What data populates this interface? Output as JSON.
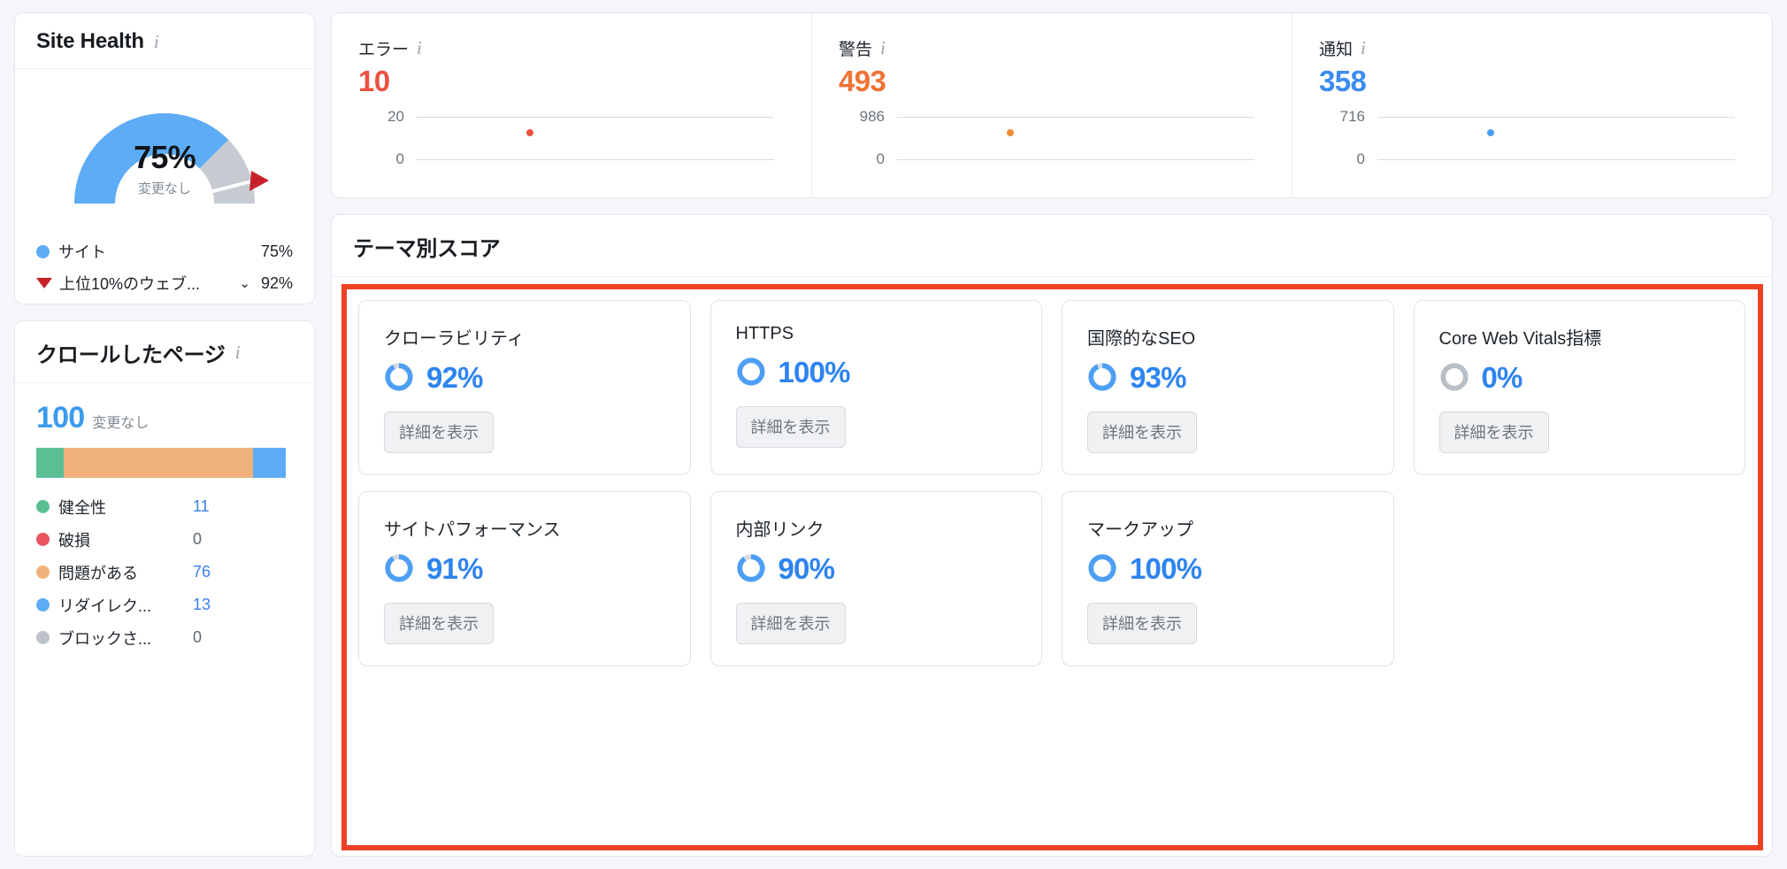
{
  "site_health": {
    "title": "Site Health",
    "info_icon": "info-icon",
    "gauge": {
      "value_label": "75%",
      "value": 75,
      "change_label": "変更なし",
      "benchmark": 92,
      "arc_color": "#5dacf5",
      "track_color": "#c6cbd1",
      "marker_color": "#c7222a"
    },
    "legend": [
      {
        "marker": "dot",
        "color": "#5dacf5",
        "label": "サイト",
        "value": "75%",
        "has_chevron": false
      },
      {
        "marker": "triangle-down",
        "color": "#c7222a",
        "label": "上位10%のウェブ...",
        "value": "92%",
        "has_chevron": true,
        "chevron": "⌄"
      }
    ]
  },
  "crawled_pages": {
    "title": "クロールしたページ",
    "info_icon": "info-icon",
    "total": "100",
    "change_label": "変更なし",
    "bar_segments": [
      {
        "color": "#5BBF96",
        "pct": 11
      },
      {
        "color": "#F0B27A",
        "pct": 76
      },
      {
        "color": "#5dacf5",
        "pct": 13
      }
    ],
    "legend": [
      {
        "color": "#5BBF96",
        "label": "健全性",
        "value": "11",
        "is_link": true
      },
      {
        "color": "#EA5561",
        "label": "破損",
        "value": "0",
        "is_link": false
      },
      {
        "color": "#F0B27A",
        "label": "問題がある",
        "value": "76",
        "is_link": true
      },
      {
        "color": "#5dacf5",
        "label": "リダイレク...",
        "value": "13",
        "is_link": true
      },
      {
        "color": "#BDC3C9",
        "label": "ブロックさ...",
        "value": "0",
        "is_link": false
      }
    ]
  },
  "issues": [
    {
      "label": "エラー",
      "value": "10",
      "color": "#ea5141",
      "axis_max": "20",
      "axis_min": "0",
      "dot_color": "#ea5141"
    },
    {
      "label": "警告",
      "value": "493",
      "color": "#ef7333",
      "axis_max": "986",
      "axis_min": "0",
      "dot_color": "#ef8e38"
    },
    {
      "label": "通知",
      "value": "358",
      "color": "#3b8cf0",
      "axis_max": "716",
      "axis_min": "0",
      "dot_color": "#4a9bf2"
    }
  ],
  "themes": {
    "title": "テーマ別スコア",
    "highlight_color": "#ef4123",
    "details_label": "詳細を表示",
    "cards": [
      {
        "name": "クローラビリティ",
        "pct_label": "92%",
        "pct": 92,
        "ring_color": "#4d9ef5"
      },
      {
        "name": "HTTPS",
        "pct_label": "100%",
        "pct": 100,
        "ring_color": "#4d9ef5"
      },
      {
        "name": "国際的なSEO",
        "pct_label": "93%",
        "pct": 93,
        "ring_color": "#4d9ef5"
      },
      {
        "name": "Core Web Vitals指標",
        "pct_label": "0%",
        "pct": 0,
        "ring_color": "#b9bfc6"
      },
      {
        "name": "サイトパフォーマンス",
        "pct_label": "91%",
        "pct": 91,
        "ring_color": "#4d9ef5"
      },
      {
        "name": "内部リンク",
        "pct_label": "90%",
        "pct": 90,
        "ring_color": "#4d9ef5"
      },
      {
        "name": "マークアップ",
        "pct_label": "100%",
        "pct": 100,
        "ring_color": "#4d9ef5"
      }
    ]
  },
  "chart_data": [
    {
      "type": "pie",
      "title": "Site Health",
      "subtitle": "変更なし",
      "categories": [
        "サイト",
        "上位10%のウェブ..."
      ],
      "values": [
        75,
        92
      ],
      "annotations": [
        "75%"
      ],
      "ylim": [
        0,
        100
      ]
    },
    {
      "type": "bar",
      "title": "クロールしたページ",
      "categories": [
        "健全性",
        "破損",
        "問題がある",
        "リダイレク...",
        "ブロックさ..."
      ],
      "values": [
        11,
        0,
        76,
        13,
        0
      ],
      "total": 100,
      "ylabel": "",
      "xlabel": ""
    },
    {
      "type": "scatter",
      "title": "エラー",
      "series": [
        {
          "name": "エラー",
          "values": [
            10
          ]
        }
      ],
      "ylim": [
        0,
        20
      ],
      "tick_labels": [
        "20",
        "0"
      ],
      "grid": true
    },
    {
      "type": "scatter",
      "title": "警告",
      "series": [
        {
          "name": "警告",
          "values": [
            493
          ]
        }
      ],
      "ylim": [
        0,
        986
      ],
      "tick_labels": [
        "986",
        "0"
      ],
      "grid": true
    },
    {
      "type": "scatter",
      "title": "通知",
      "series": [
        {
          "name": "通知",
          "values": [
            358
          ]
        }
      ],
      "ylim": [
        0,
        716
      ],
      "tick_labels": [
        "716",
        "0"
      ],
      "grid": true
    },
    {
      "type": "bar",
      "title": "テーマ別スコア",
      "categories": [
        "クローラビリティ",
        "HTTPS",
        "国際的なSEO",
        "Core Web Vitals指標",
        "サイトパフォーマンス",
        "内部リンク",
        "マークアップ"
      ],
      "values": [
        92,
        100,
        93,
        0,
        91,
        90,
        100
      ],
      "ylabel": "%",
      "ylim": [
        0,
        100
      ]
    }
  ]
}
